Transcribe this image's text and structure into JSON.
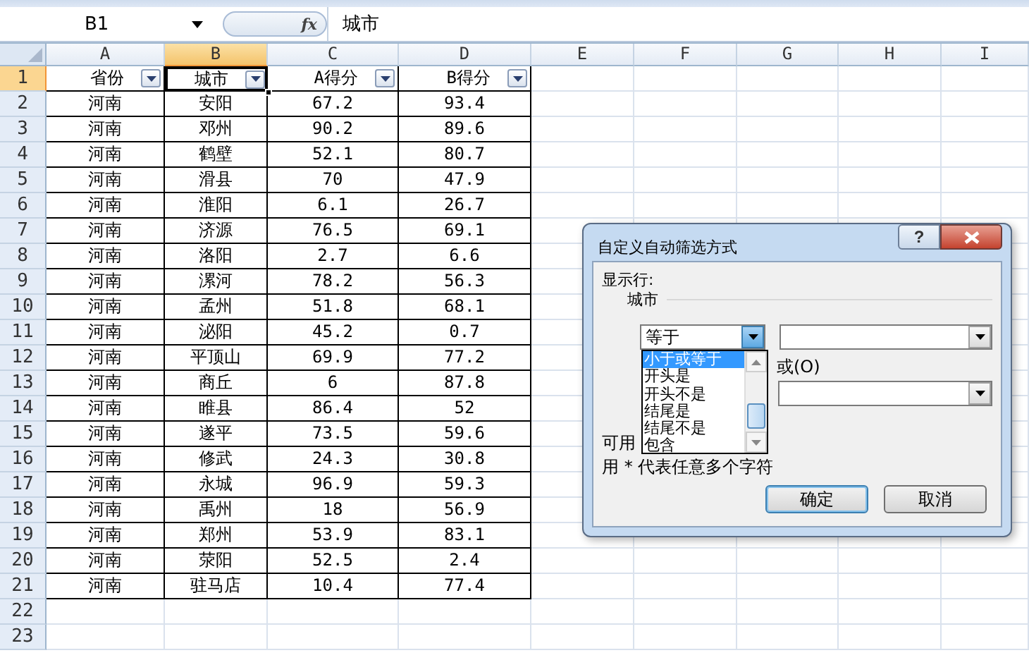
{
  "name_box": "B1",
  "formula_bar": {
    "fx": "fx",
    "value": "城市"
  },
  "columns": [
    {
      "label": "A",
      "selected": false
    },
    {
      "label": "B",
      "selected": true
    },
    {
      "label": "C",
      "selected": false
    },
    {
      "label": "D",
      "selected": false
    },
    {
      "label": "E",
      "selected": false
    },
    {
      "label": "F",
      "selected": false
    },
    {
      "label": "G",
      "selected": false
    },
    {
      "label": "H",
      "selected": false
    },
    {
      "label": "I",
      "selected": false
    }
  ],
  "header_row": {
    "number": "1",
    "selected": true,
    "cells": [
      {
        "text": "省份",
        "active": false
      },
      {
        "text": "城市",
        "active": true
      },
      {
        "text": "A得分",
        "active": false
      },
      {
        "text": "B得分",
        "active": false
      }
    ]
  },
  "rows": [
    {
      "number": "2",
      "cells": [
        "河南",
        "安阳",
        "67.2",
        "93.4"
      ]
    },
    {
      "number": "3",
      "cells": [
        "河南",
        "邓州",
        "90.2",
        "89.6"
      ]
    },
    {
      "number": "4",
      "cells": [
        "河南",
        "鹤壁",
        "52.1",
        "80.7"
      ]
    },
    {
      "number": "5",
      "cells": [
        "河南",
        "滑县",
        "70",
        "47.9"
      ]
    },
    {
      "number": "6",
      "cells": [
        "河南",
        "淮阳",
        "6.1",
        "26.7"
      ]
    },
    {
      "number": "7",
      "cells": [
        "河南",
        "济源",
        "76.5",
        "69.1"
      ]
    },
    {
      "number": "8",
      "cells": [
        "河南",
        "洛阳",
        "2.7",
        "6.6"
      ]
    },
    {
      "number": "9",
      "cells": [
        "河南",
        "漯河",
        "78.2",
        "56.3"
      ]
    },
    {
      "number": "10",
      "cells": [
        "河南",
        "孟州",
        "51.8",
        "68.1"
      ]
    },
    {
      "number": "11",
      "cells": [
        "河南",
        "泌阳",
        "45.2",
        "0.7"
      ]
    },
    {
      "number": "12",
      "cells": [
        "河南",
        "平顶山",
        "69.9",
        "77.2"
      ]
    },
    {
      "number": "13",
      "cells": [
        "河南",
        "商丘",
        "6",
        "87.8"
      ]
    },
    {
      "number": "14",
      "cells": [
        "河南",
        "睢县",
        "86.4",
        "52"
      ]
    },
    {
      "number": "15",
      "cells": [
        "河南",
        "遂平",
        "73.5",
        "59.6"
      ]
    },
    {
      "number": "16",
      "cells": [
        "河南",
        "修武",
        "24.3",
        "30.8"
      ]
    },
    {
      "number": "17",
      "cells": [
        "河南",
        "永城",
        "96.9",
        "59.3"
      ]
    },
    {
      "number": "18",
      "cells": [
        "河南",
        "禹州",
        "18",
        "56.9"
      ]
    },
    {
      "number": "19",
      "cells": [
        "河南",
        "郑州",
        "53.9",
        "83.1"
      ]
    },
    {
      "number": "20",
      "cells": [
        "河南",
        "荥阳",
        "52.5",
        "2.4"
      ]
    },
    {
      "number": "21",
      "cells": [
        "河南",
        "驻马店",
        "10.4",
        "77.4"
      ]
    },
    {
      "number": "22",
      "cells": []
    },
    {
      "number": "23",
      "cells": []
    }
  ],
  "dialog": {
    "title": "自定义自动筛选方式",
    "help": "?",
    "show_rows_label": "显示行:",
    "field_name": "城市",
    "condition_1": {
      "operator": "等于"
    },
    "operator_list": [
      {
        "label": "小于或等于",
        "selected": true
      },
      {
        "label": "开头是",
        "selected": false
      },
      {
        "label": "开头不是",
        "selected": false
      },
      {
        "label": "结尾是",
        "selected": false
      },
      {
        "label": "结尾不是",
        "selected": false
      },
      {
        "label": "包含",
        "selected": false
      }
    ],
    "or_option": "或(O)",
    "hint_1": "可用",
    "hint_2": "用 * 代表任意多个字符",
    "buttons": [
      {
        "label": "确定",
        "default": true
      },
      {
        "label": "取消",
        "default": false
      }
    ]
  }
}
